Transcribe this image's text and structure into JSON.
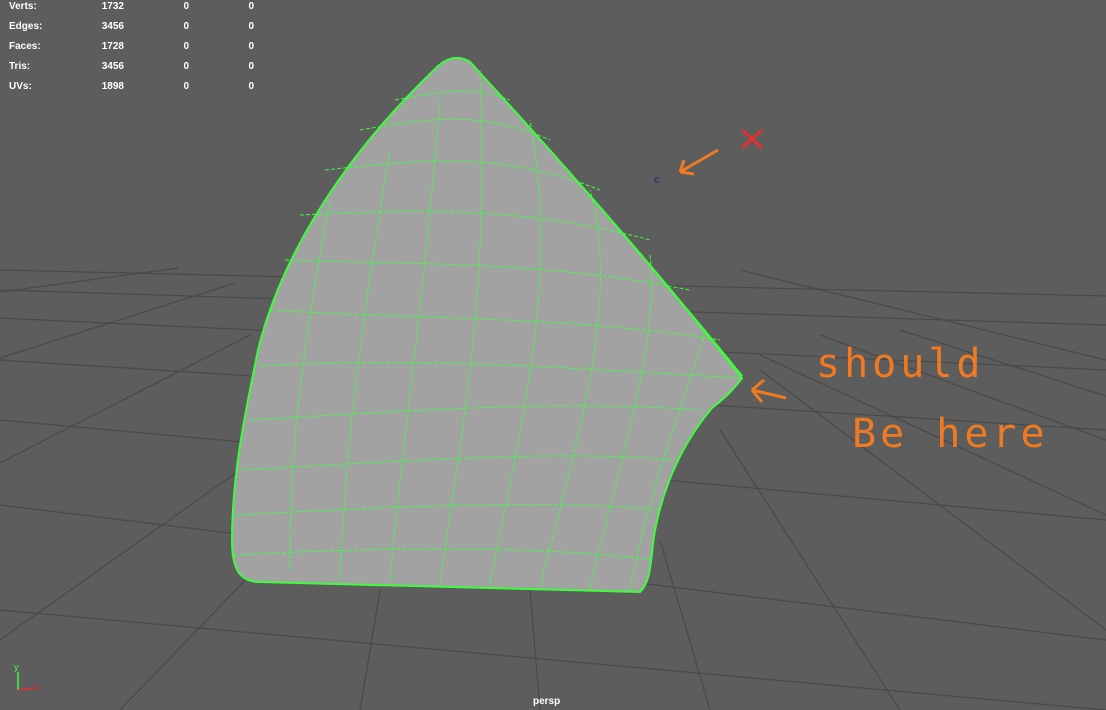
{
  "stats": {
    "rows": [
      {
        "label": "Verts:",
        "v1": "1732",
        "v2": "0",
        "v3": "0"
      },
      {
        "label": "Edges:",
        "v1": "3456",
        "v2": "0",
        "v3": "0"
      },
      {
        "label": "Faces:",
        "v1": "1728",
        "v2": "0",
        "v3": "0"
      },
      {
        "label": "Tris:",
        "v1": "3456",
        "v2": "0",
        "v3": "0"
      },
      {
        "label": "UVs:",
        "v1": "1898",
        "v2": "0",
        "v3": "0"
      }
    ]
  },
  "viewport": {
    "camera": "persp",
    "pivot_label": "c"
  },
  "annotations": {
    "line1": "should",
    "line2": "Be here"
  },
  "axis": {
    "y": "y",
    "x": "x"
  },
  "colors": {
    "background": "#5d5d5d",
    "grid": "#4a4a4a",
    "mesh_fill": "#a0a0a0",
    "wireframe": "#3cff3c",
    "annotation": "#f07a22",
    "cross": "#e03030"
  }
}
